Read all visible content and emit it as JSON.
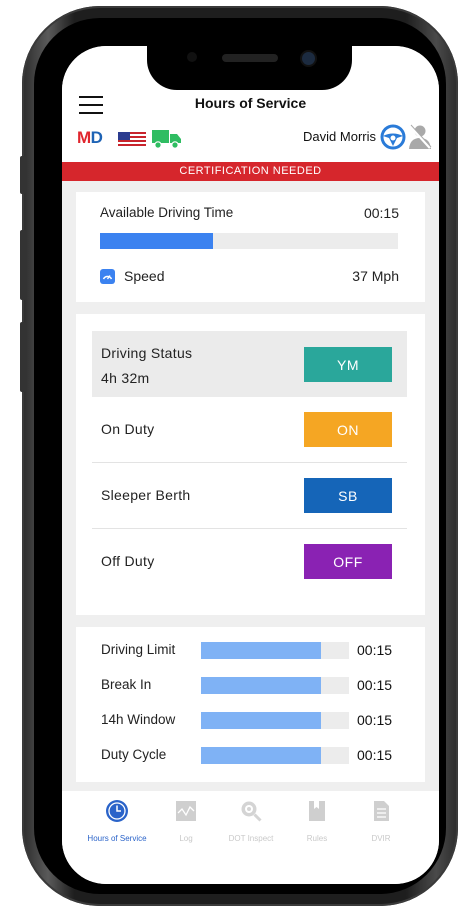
{
  "header": {
    "title": "Hours of Service",
    "logo_m": "M",
    "logo_d": "D",
    "driver_name": "David Morris"
  },
  "banner": {
    "text": "CERTIFICATION NEEDED"
  },
  "driving": {
    "available_label": "Available Driving Time",
    "available_value": "00:15",
    "available_progress": 0.38,
    "speed_label": "Speed",
    "speed_value": "37 Mph"
  },
  "statuses": [
    {
      "name": "Driving Status",
      "sub": "4h 32m",
      "button": "YM",
      "color": "#2aa79b"
    },
    {
      "name": "On Duty",
      "button": "ON",
      "color": "#f5a623"
    },
    {
      "name": "Sleeper Berth",
      "button": "SB",
      "color": "#1565b8"
    },
    {
      "name": "Off Duty",
      "button": "OFF",
      "color": "#8a22b3"
    }
  ],
  "limits": [
    {
      "name": "Driving Limit",
      "value": "00:15",
      "progress": 0.81
    },
    {
      "name": "Break In",
      "value": "00:15",
      "progress": 0.81
    },
    {
      "name": "14h Window",
      "value": "00:15",
      "progress": 0.81
    },
    {
      "name": "Duty Cycle",
      "value": "00:15",
      "progress": 0.81
    }
  ],
  "nav": [
    {
      "label": "Hours of Service",
      "icon": "clock-icon",
      "active": true
    },
    {
      "label": "Log",
      "icon": "log-chart-icon"
    },
    {
      "label": "DOT Inspect",
      "icon": "inspect-magnifier-icon"
    },
    {
      "label": "Rules",
      "icon": "rules-book-icon"
    },
    {
      "label": "DVIR",
      "icon": "dvir-document-icon"
    }
  ],
  "colors": {
    "accent": "#3b82f0",
    "banner": "#d6262c",
    "nav_active": "#2a63c9"
  }
}
